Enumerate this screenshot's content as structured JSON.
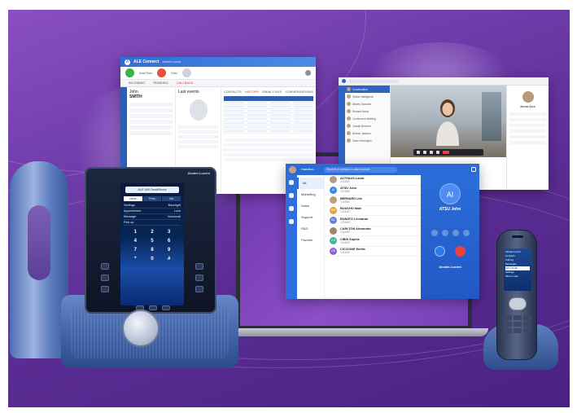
{
  "agent_window": {
    "title": "ALE Connect",
    "user": "Alcatel-Lucent",
    "call_labels": [
      "Ana Ruiz",
      "Hold"
    ],
    "tabs": [
      "INCOMING",
      "PENDING",
      "CALLBACK"
    ],
    "customer_first": "John",
    "customer_last": "SMITH",
    "section_label": "Last events",
    "table_tabs": [
      "CONTACTS",
      "HISTORY",
      "EMAIL FILES",
      "CONVERSATIONS"
    ]
  },
  "video_window": {
    "contact_name": "Anna Doe",
    "list_names": [
      "Conversation",
      "Online Intelligence",
      "Mickey Sanchez",
      "Richard Harris",
      "Conference Meeting",
      "Joseph Bertram",
      "Dereck Jackson",
      "Victor Harrington"
    ]
  },
  "contact_window": {
    "user_name": "Hamilton",
    "search_placeholder": "Search a contact or dial number",
    "menu": [
      "All",
      "Marketing",
      "Sales",
      "Support",
      "R&D",
      "Favorite"
    ],
    "contacts": [
      {
        "initials": "",
        "name": "ALTHAUS Laura",
        "num": "1234567",
        "color": "#b69a86"
      },
      {
        "initials": "AI",
        "name": "ATSU John",
        "num": "1234567",
        "color": "#3f86e8"
      },
      {
        "initials": "",
        "name": "BERNARD Lila",
        "num": "1234567",
        "color": "#c29a7d"
      },
      {
        "initials": "BM",
        "name": "BOUCHO Matt",
        "num": "1234567",
        "color": "#e8a33b"
      },
      {
        "initials": "BL",
        "name": "BUNATO Leonardo",
        "num": "1234567",
        "color": "#6a7ee0"
      },
      {
        "initials": "",
        "name": "CARLTON Alexandra",
        "num": "1234567",
        "color": "#a38470"
      },
      {
        "initials": "CS",
        "name": "CIBIS Sophie",
        "num": "1234567",
        "color": "#3db39c"
      },
      {
        "initials": "CE",
        "name": "CICCIONE Emilie",
        "num": "1234567",
        "color": "#8f63d6"
      }
    ],
    "call_initials": "AI",
    "call_name": "ATSU John",
    "brand": "Alcatel-Lucent"
  },
  "desk_phone": {
    "brand": "Alcatel-Lucent",
    "screen_title": "ALE 500 DeskPhone",
    "tabs": [
      "Home",
      "Perso",
      "Info"
    ],
    "menu": [
      {
        "label": "Settings",
        "value": "Backlight"
      },
      {
        "label": "Appointment",
        "value": "Lock"
      },
      {
        "label": "Message",
        "value": "Voicemail"
      },
      {
        "label": "Pick up",
        "value": ""
      }
    ],
    "keys": [
      "1",
      "2",
      "3",
      "4",
      "5",
      "6",
      "7",
      "8",
      "9",
      "*",
      "0",
      "#"
    ]
  },
  "dect_phone": {
    "screen_lines": [
      "Alcatel-Lucent",
      "Contacts",
      "Call log",
      "Messages",
      "John Smith",
      "Settings",
      "Silent mode"
    ]
  }
}
